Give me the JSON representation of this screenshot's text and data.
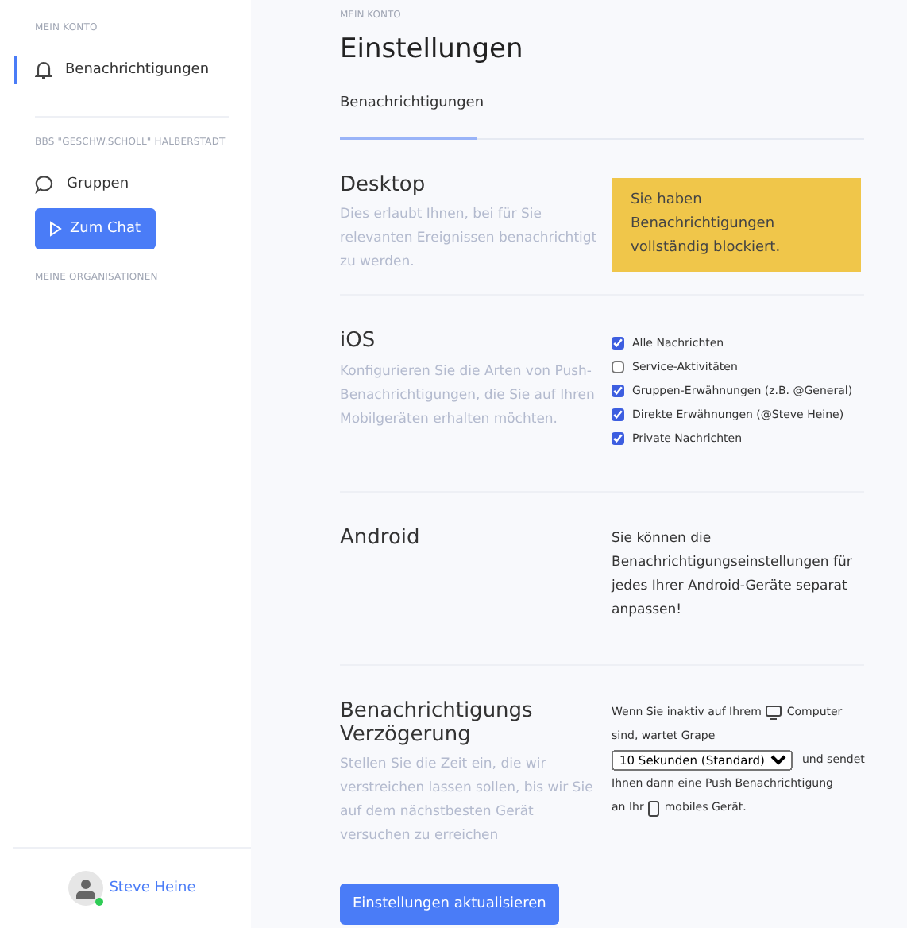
{
  "sidebar": {
    "account_label": "MEIN KONTO",
    "account_items": [
      {
        "label": "Benachrichtigungen",
        "selected": true
      }
    ],
    "org_label": "BBS \"GESCHW.SCHOLL\" HALBERSTADT",
    "org_items": [
      {
        "label": "Gruppen",
        "selected": false
      }
    ],
    "chat_button": "Zum Chat",
    "organizations_label": "MEINE ORGANISATIONEN",
    "user": {
      "name": "Steve Heine",
      "online": true
    }
  },
  "main": {
    "breadcrumb": "MEIN KONTO",
    "title": "Einstellungen",
    "tabs": [
      {
        "label": "Benachrichtigungen",
        "selected": true
      }
    ],
    "sections": [
      {
        "kind": "alert",
        "title": "Desktop",
        "description": "Dies erlaubt Ihnen, bei für Sie relevanten Ereignissen benachrichtigt zu werden.",
        "alert": "Sie haben Benachrichtigungen vollständig blockiert."
      },
      {
        "kind": "checkboxes",
        "title": "iOS",
        "description": "Konfigurieren Sie die Arten von Push-Benachrichtigungen, die Sie auf Ihren Mobilgeräten erhalten möchten.",
        "options": [
          {
            "label": "Alle Nachrichten",
            "checked": true
          },
          {
            "label": "Service-Aktivitäten",
            "checked": false
          },
          {
            "label": "Gruppen-Erwähnungen (z.B. @General)",
            "checked": true
          },
          {
            "label": "Direkte Erwähnungen (@Steve Heine)",
            "checked": true
          },
          {
            "label": "Private Nachrichten",
            "checked": true
          }
        ]
      },
      {
        "kind": "text",
        "title": "Android",
        "text": "Sie können die Benachrichtigungseinstellungen für jedes Ihrer Android-Geräte separat anpassen!"
      },
      {
        "kind": "delay",
        "title": "Benachrichtigungs Verzögerung",
        "description": "Stellen Sie die Zeit ein, die wir verstreichen lassen sollen, bis wir Sie auf dem nächstbesten Gerät versuchen zu erreichen",
        "intro": "Wenn Sie inaktiv auf Ihrem",
        "computer": "Computer",
        "intro_end": "sind, wartet Grape",
        "select_value": "10 Sekunden (Standard)",
        "after_select": "und sendet",
        "line_4": "Ihnen dann eine Push Benachrichtigung",
        "prefix_5": "an Ihr",
        "mobile": "mobiles Gerät."
      }
    ],
    "submit_button": "Einstellungen aktualisieren"
  }
}
